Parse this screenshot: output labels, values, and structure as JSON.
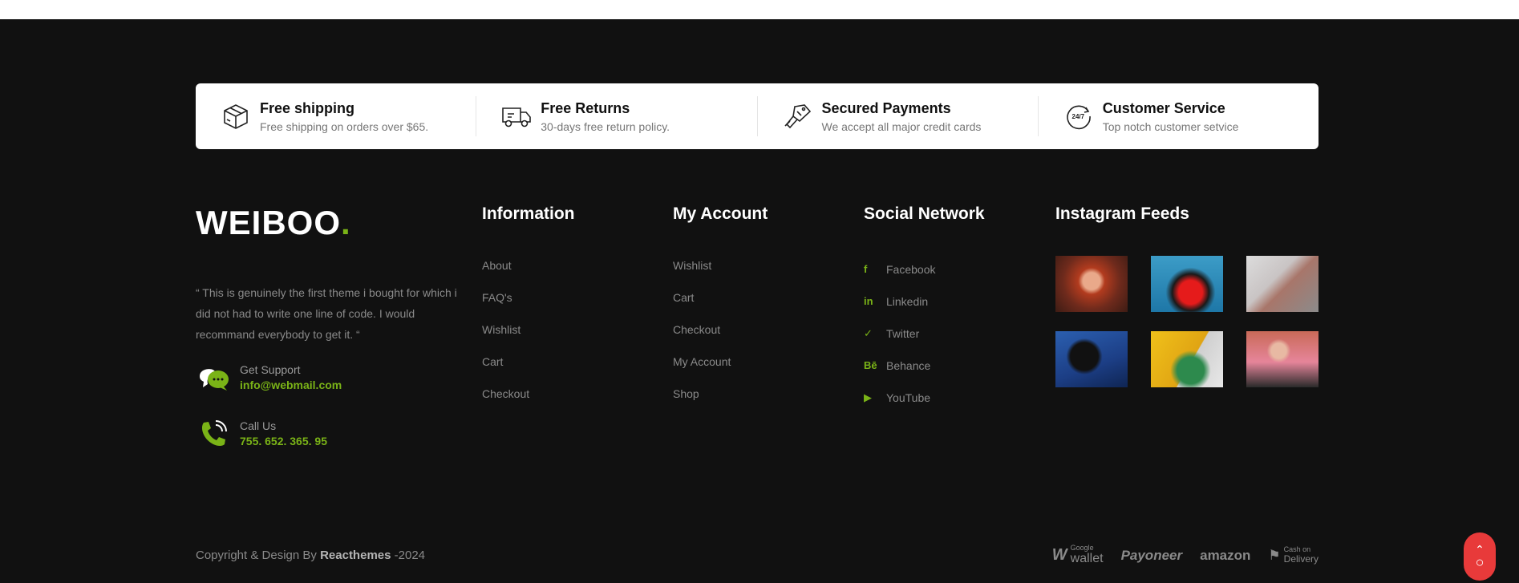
{
  "features": [
    {
      "icon": "box-icon",
      "title": "Free shipping",
      "subtitle": "Free shipping on orders over $65."
    },
    {
      "icon": "truck-icon",
      "title": "Free Returns",
      "subtitle": "30-days free return policy."
    },
    {
      "icon": "card-hand-icon",
      "title": "Secured Payments",
      "subtitle": "We accept all major credit cards"
    },
    {
      "icon": "24-7-icon",
      "title": "Customer Service",
      "subtitle": "Top notch customer setvice"
    }
  ],
  "brand": {
    "logo_text": "WEIBOO",
    "logo_dot": ".",
    "quote": "“ This is genuinely the first theme i bought for which i did not had to write one line of code. I would recommand everybody to get it. “",
    "accent_color": "#7ab317"
  },
  "contacts": [
    {
      "icon": "chat-bubble-icon",
      "label": "Get Support",
      "value": "info@webmail.com"
    },
    {
      "icon": "phone-icon",
      "label": "Call Us",
      "value": "755. 652. 365. 95"
    }
  ],
  "information": {
    "title": "Information",
    "links": [
      "About",
      "FAQ's",
      "Wishlist",
      "Cart",
      "Checkout"
    ]
  },
  "account": {
    "title": "My Account",
    "links": [
      "Wishlist",
      "Cart",
      "Checkout",
      "My Account",
      "Shop"
    ]
  },
  "social": {
    "title": "Social Network",
    "links": [
      {
        "icon": "f",
        "label": "Facebook"
      },
      {
        "icon": "in",
        "label": "Linkedin"
      },
      {
        "icon": "✓",
        "label": "Twitter"
      },
      {
        "icon": "Bē",
        "label": "Behance"
      },
      {
        "icon": "▶",
        "label": "YouTube"
      }
    ]
  },
  "instagram": {
    "title": "Instagram Feeds",
    "images": [
      "instagram-photo-1",
      "instagram-photo-2",
      "instagram-photo-3",
      "instagram-photo-4",
      "instagram-photo-5",
      "instagram-photo-6"
    ]
  },
  "copyright": {
    "prefix": "Copyright & Design By ",
    "brand": "Reacthemes",
    "suffix": " -2024"
  },
  "payments": {
    "wallet_small": "Google",
    "wallet": "wallet",
    "payoneer": "Payoneer",
    "amazon": "amazon",
    "delivery_small": "Cash on",
    "delivery": "Delivery"
  },
  "scroll_top": {
    "arrow": "⌃",
    "ring": "○"
  }
}
